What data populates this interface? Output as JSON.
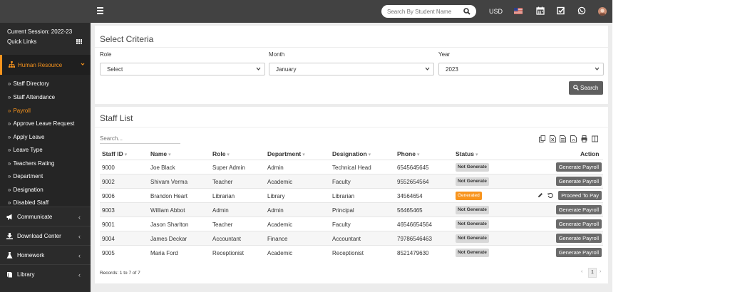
{
  "topbar": {
    "search_placeholder": "Search By Student Name",
    "currency": "USD",
    "icons": [
      "menu-icon",
      "search-icon",
      "us-flag-icon",
      "calendar-icon",
      "tasks-check-icon",
      "whatsapp-icon",
      "user-avatar"
    ]
  },
  "sidebar": {
    "session": "Current Session: 2022-23",
    "quick_links": "Quick Links",
    "active_section": "Human Resource",
    "sub_items": [
      "Staff Directory",
      "Staff Attendance",
      "Payroll",
      "Approve Leave Request",
      "Apply Leave",
      "Leave Type",
      "Teachers Rating",
      "Department",
      "Designation",
      "Disabled Staff"
    ],
    "active_sub": "Payroll",
    "menus": [
      "Communicate",
      "Download Center",
      "Homework",
      "Library"
    ],
    "accent": "#f8941d"
  },
  "criteria": {
    "title": "Select Criteria",
    "role_label": "Role",
    "role_value": "Select",
    "month_label": "Month",
    "month_value": "January",
    "year_label": "Year",
    "year_value": "2023",
    "search_button": "Search"
  },
  "staff_list": {
    "title": "Staff List",
    "search_placeholder": "Search...",
    "columns": [
      "Staff ID",
      "Name",
      "Role",
      "Department",
      "Designation",
      "Phone",
      "Status",
      "Action"
    ],
    "rows": [
      {
        "id": "9000",
        "name": "Joe Black",
        "role": "Super Admin",
        "department": "Admin",
        "designation": "Technical Head",
        "phone": "6545645645",
        "status": "Not Generate",
        "action": "Generate Payroll"
      },
      {
        "id": "9002",
        "name": "Shivam Verma",
        "role": "Teacher",
        "department": "Academic",
        "designation": "Faculty",
        "phone": "9552654564",
        "status": "Not Generate",
        "action": "Generate Payroll"
      },
      {
        "id": "9006",
        "name": "Brandon Heart",
        "role": "Librarian",
        "department": "Library",
        "designation": "Librarian",
        "phone": "34564654",
        "status": "Generated",
        "action": "Proceed To Pay"
      },
      {
        "id": "9003",
        "name": "William Abbot",
        "role": "Admin",
        "department": "Admin",
        "designation": "Principal",
        "phone": "56465465",
        "status": "Not Generate",
        "action": "Generate Payroll"
      },
      {
        "id": "9001",
        "name": "Jason Sharlton",
        "role": "Teacher",
        "department": "Academic",
        "designation": "Faculty",
        "phone": "46546654564",
        "status": "Not Generate",
        "action": "Generate Payroll"
      },
      {
        "id": "9004",
        "name": "James Deckar",
        "role": "Accountant",
        "department": "Finance",
        "designation": "Accountant",
        "phone": "79786546463",
        "status": "Not Generate",
        "action": "Generate Payroll"
      },
      {
        "id": "9005",
        "name": "Maria Ford",
        "role": "Receptionist",
        "department": "Academic",
        "designation": "Receptionist",
        "phone": "8521479630",
        "status": "Not Generate",
        "action": "Generate Payroll"
      }
    ],
    "records": "Records: 1 to 7 of 7",
    "page": "1",
    "generated_color": "#f8941d"
  }
}
